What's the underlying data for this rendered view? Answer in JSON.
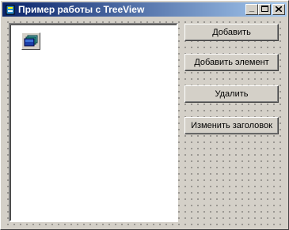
{
  "window": {
    "title": "Пример работы с TreeView",
    "minimize_glyph": "_",
    "maximize_glyph": "□",
    "close_glyph": "✕"
  },
  "tree": {
    "icon": "imagelist-icon"
  },
  "buttons": {
    "add": "Добавить",
    "add_item": "Добавить элемент",
    "delete": "Удалить",
    "rename": "Изменить заголовок"
  }
}
